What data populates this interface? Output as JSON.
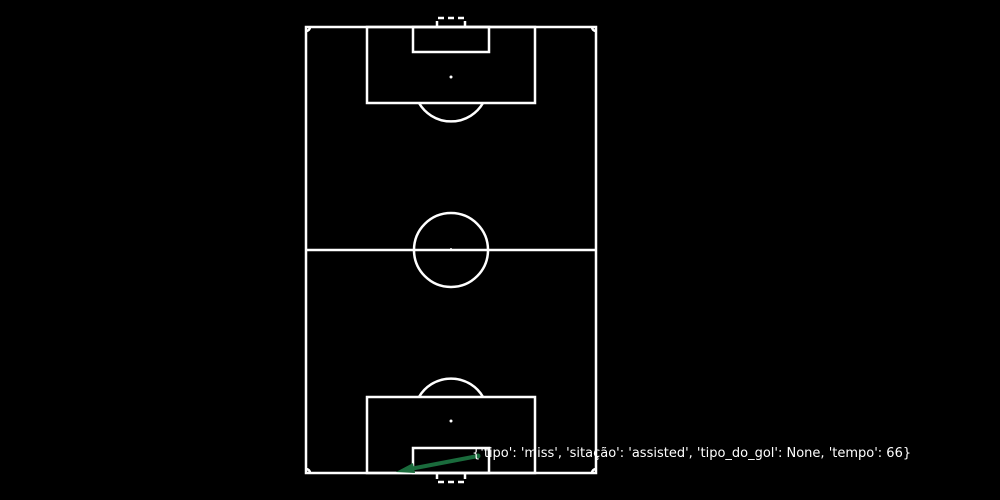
{
  "theme": {
    "background": "#000000",
    "line_color": "#ffffff",
    "shot_color": "#1a6b3c"
  },
  "shot": {
    "label": "{'tipo': 'miss', 'sitação': 'assisted', 'tipo_do_gol': None, 'tempo': 66}",
    "tipo": "miss",
    "situacao": "assisted",
    "tipo_do_gol": "None",
    "tempo": 66
  }
}
